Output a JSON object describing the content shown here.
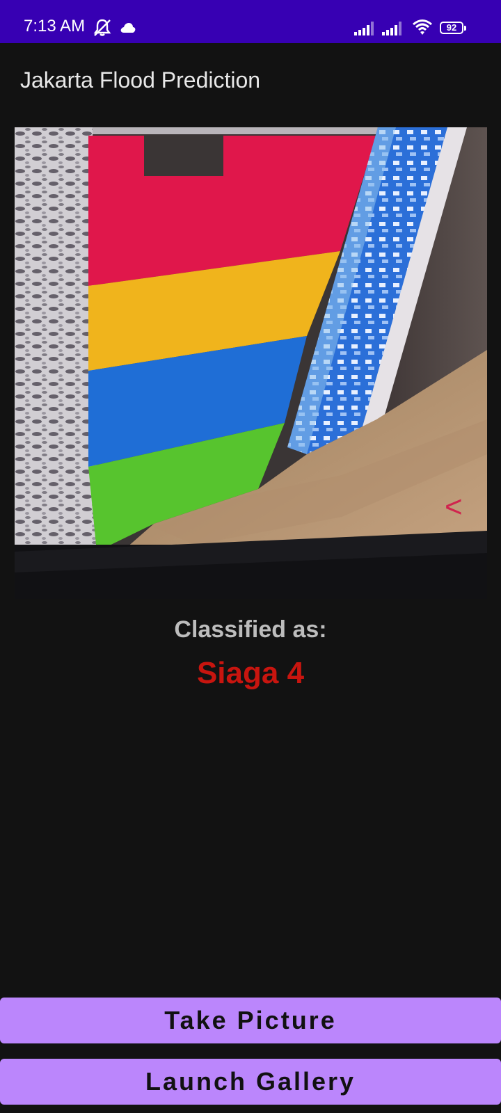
{
  "status_bar": {
    "time": "7:13 AM",
    "battery_level": "92",
    "icons": [
      "mute-icon",
      "cloud-icon",
      "signal-icon",
      "signal-icon",
      "wifi-icon",
      "battery-icon"
    ]
  },
  "app": {
    "title": "Jakarta Flood Prediction"
  },
  "preview": {
    "mark_glyph": "<"
  },
  "result": {
    "label": "Classified as:",
    "value": "Siaga 4",
    "value_color": "#c8150f"
  },
  "buttons": {
    "take_picture": "Take Picture",
    "launch_gallery": "Launch Gallery"
  },
  "colors": {
    "status_bar": "#3700b3",
    "background": "#121212",
    "button": "#bb86fc"
  }
}
